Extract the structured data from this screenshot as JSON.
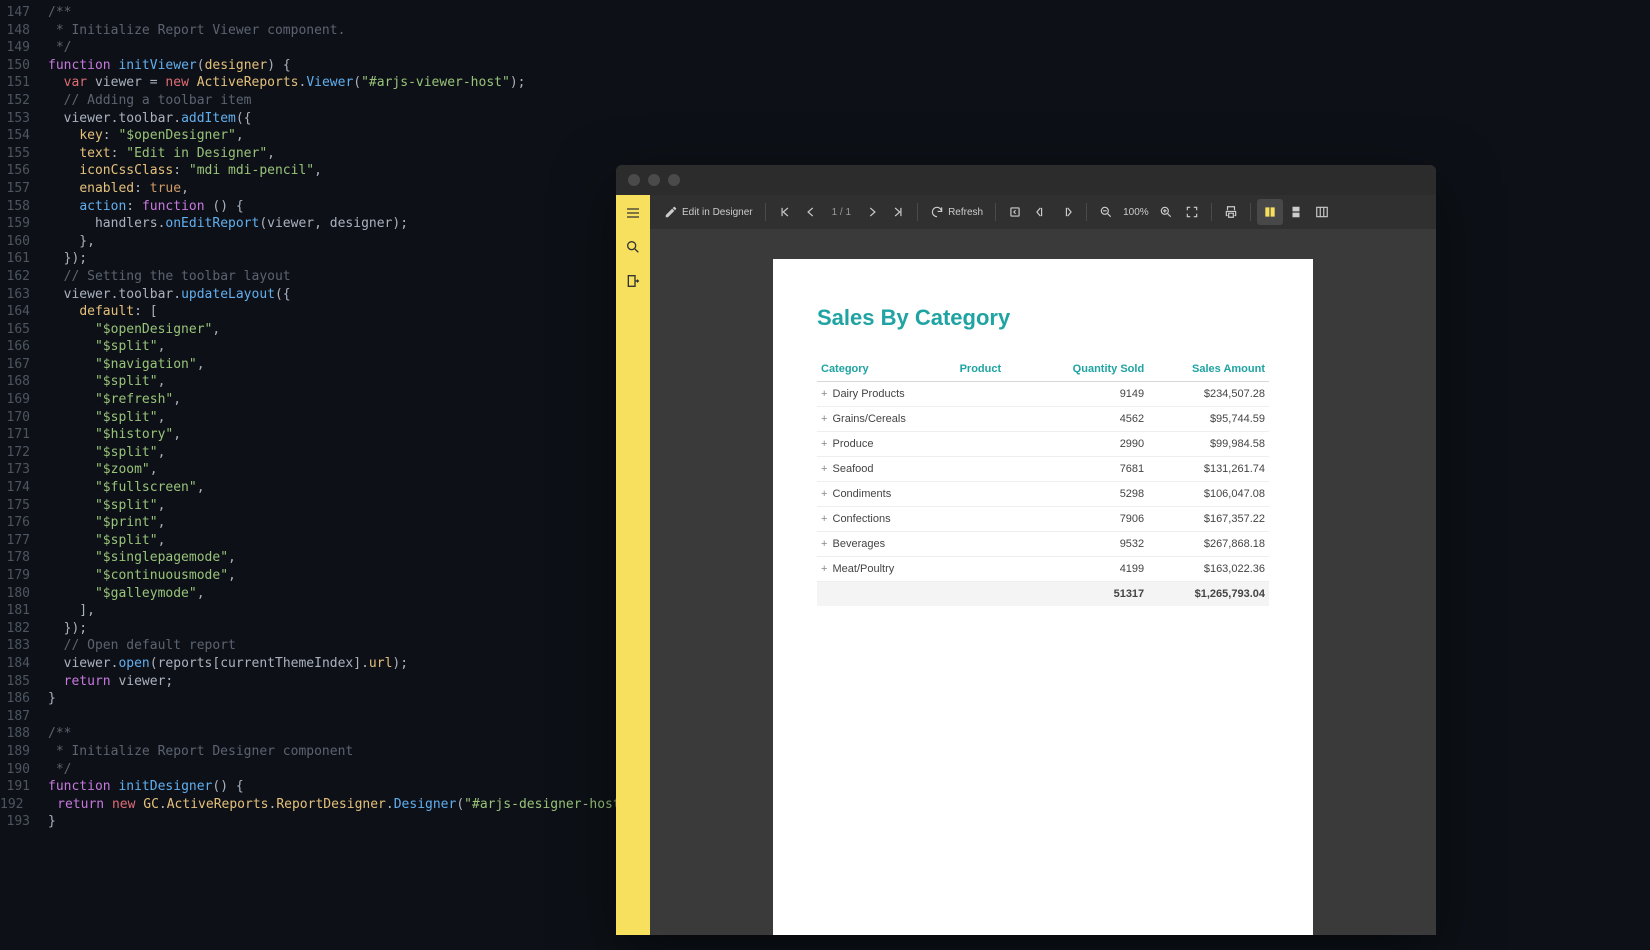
{
  "code": {
    "startLine": 147,
    "lines": [
      [
        [
          "c",
          "/**"
        ]
      ],
      [
        [
          "c",
          " * Initialize Report Viewer component."
        ]
      ],
      [
        [
          "c",
          " */"
        ]
      ],
      [
        [
          "k",
          "function"
        ],
        [
          "p",
          " "
        ],
        [
          "fn",
          "initViewer"
        ],
        [
          "p",
          "("
        ],
        [
          "ob",
          "designer"
        ],
        [
          "p",
          ") {"
        ]
      ],
      [
        [
          "p",
          "  "
        ],
        [
          "kw2",
          "var"
        ],
        [
          "p",
          " viewer = "
        ],
        [
          "kw2",
          "new"
        ],
        [
          "p",
          " "
        ],
        [
          "ob",
          "ActiveReports"
        ],
        [
          "p",
          "."
        ],
        [
          "fn",
          "Viewer"
        ],
        [
          "p",
          "("
        ],
        [
          "s",
          "\"#arjs-viewer-host\""
        ],
        [
          "p",
          ");"
        ]
      ],
      [
        [
          "p",
          "  "
        ],
        [
          "c",
          "// Adding a toolbar item"
        ]
      ],
      [
        [
          "p",
          "  viewer.toolbar."
        ],
        [
          "fn",
          "addItem"
        ],
        [
          "p",
          "({"
        ]
      ],
      [
        [
          "p",
          "    "
        ],
        [
          "ob",
          "key"
        ],
        [
          "p",
          ": "
        ],
        [
          "s",
          "\"$openDesigner\""
        ],
        [
          "p",
          ","
        ]
      ],
      [
        [
          "p",
          "    "
        ],
        [
          "ob",
          "text"
        ],
        [
          "p",
          ": "
        ],
        [
          "s",
          "\"Edit in Designer\""
        ],
        [
          "p",
          ","
        ]
      ],
      [
        [
          "p",
          "    "
        ],
        [
          "ob",
          "iconCssClass"
        ],
        [
          "p",
          ": "
        ],
        [
          "s",
          "\"mdi mdi-pencil\""
        ],
        [
          "p",
          ","
        ]
      ],
      [
        [
          "p",
          "    "
        ],
        [
          "ob",
          "enabled"
        ],
        [
          "p",
          ": "
        ],
        [
          "bool",
          "true"
        ],
        [
          "p",
          ","
        ]
      ],
      [
        [
          "p",
          "    "
        ],
        [
          "fn",
          "action"
        ],
        [
          "p",
          ": "
        ],
        [
          "k",
          "function"
        ],
        [
          "p",
          " () {"
        ]
      ],
      [
        [
          "p",
          "      handlers."
        ],
        [
          "fn",
          "onEditReport"
        ],
        [
          "p",
          "(viewer, designer);"
        ]
      ],
      [
        [
          "p",
          "    },"
        ]
      ],
      [
        [
          "p",
          "  });"
        ]
      ],
      [
        [
          "p",
          "  "
        ],
        [
          "c",
          "// Setting the toolbar layout"
        ]
      ],
      [
        [
          "p",
          "  viewer.toolbar."
        ],
        [
          "fn",
          "updateLayout"
        ],
        [
          "p",
          "({"
        ]
      ],
      [
        [
          "p",
          "    "
        ],
        [
          "ob",
          "default"
        ],
        [
          "p",
          ": ["
        ]
      ],
      [
        [
          "p",
          "      "
        ],
        [
          "s",
          "\"$openDesigner\""
        ],
        [
          "p",
          ","
        ]
      ],
      [
        [
          "p",
          "      "
        ],
        [
          "s",
          "\"$split\""
        ],
        [
          "p",
          ","
        ]
      ],
      [
        [
          "p",
          "      "
        ],
        [
          "s",
          "\"$navigation\""
        ],
        [
          "p",
          ","
        ]
      ],
      [
        [
          "p",
          "      "
        ],
        [
          "s",
          "\"$split\""
        ],
        [
          "p",
          ","
        ]
      ],
      [
        [
          "p",
          "      "
        ],
        [
          "s",
          "\"$refresh\""
        ],
        [
          "p",
          ","
        ]
      ],
      [
        [
          "p",
          "      "
        ],
        [
          "s",
          "\"$split\""
        ],
        [
          "p",
          ","
        ]
      ],
      [
        [
          "p",
          "      "
        ],
        [
          "s",
          "\"$history\""
        ],
        [
          "p",
          ","
        ]
      ],
      [
        [
          "p",
          "      "
        ],
        [
          "s",
          "\"$split\""
        ],
        [
          "p",
          ","
        ]
      ],
      [
        [
          "p",
          "      "
        ],
        [
          "s",
          "\"$zoom\""
        ],
        [
          "p",
          ","
        ]
      ],
      [
        [
          "p",
          "      "
        ],
        [
          "s",
          "\"$fullscreen\""
        ],
        [
          "p",
          ","
        ]
      ],
      [
        [
          "p",
          "      "
        ],
        [
          "s",
          "\"$split\""
        ],
        [
          "p",
          ","
        ]
      ],
      [
        [
          "p",
          "      "
        ],
        [
          "s",
          "\"$print\""
        ],
        [
          "p",
          ","
        ]
      ],
      [
        [
          "p",
          "      "
        ],
        [
          "s",
          "\"$split\""
        ],
        [
          "p",
          ","
        ]
      ],
      [
        [
          "p",
          "      "
        ],
        [
          "s",
          "\"$singlepagemode\""
        ],
        [
          "p",
          ","
        ]
      ],
      [
        [
          "p",
          "      "
        ],
        [
          "s",
          "\"$continuousmode\""
        ],
        [
          "p",
          ","
        ]
      ],
      [
        [
          "p",
          "      "
        ],
        [
          "s",
          "\"$galleymode\""
        ],
        [
          "p",
          ","
        ]
      ],
      [
        [
          "p",
          "    ],"
        ]
      ],
      [
        [
          "p",
          "  });"
        ]
      ],
      [
        [
          "p",
          "  "
        ],
        [
          "c",
          "// Open default report"
        ]
      ],
      [
        [
          "p",
          "  viewer."
        ],
        [
          "fn",
          "open"
        ],
        [
          "p",
          "(reports[currentThemeIndex]."
        ],
        [
          "ob",
          "url"
        ],
        [
          "p",
          ");"
        ]
      ],
      [
        [
          "p",
          "  "
        ],
        [
          "k",
          "return"
        ],
        [
          "p",
          " viewer;"
        ]
      ],
      [
        [
          "p",
          "}"
        ]
      ],
      [
        [
          "p",
          ""
        ]
      ],
      [
        [
          "c",
          "/**"
        ]
      ],
      [
        [
          "c",
          " * Initialize Report Designer component"
        ]
      ],
      [
        [
          "c",
          " */"
        ]
      ],
      [
        [
          "k",
          "function"
        ],
        [
          "p",
          " "
        ],
        [
          "fn",
          "initDesigner"
        ],
        [
          "p",
          "() {"
        ]
      ],
      [
        [
          "p",
          "  "
        ],
        [
          "k",
          "return"
        ],
        [
          "p",
          " "
        ],
        [
          "kw2",
          "new"
        ],
        [
          "p",
          " "
        ],
        [
          "ob",
          "GC"
        ],
        [
          "p",
          "."
        ],
        [
          "ob",
          "ActiveReports"
        ],
        [
          "p",
          "."
        ],
        [
          "ob",
          "ReportDesigner"
        ],
        [
          "p",
          "."
        ],
        [
          "fn",
          "Designer"
        ],
        [
          "p",
          "("
        ],
        [
          "s",
          "\"#arjs-designer-host\""
        ],
        [
          "p",
          ");"
        ]
      ],
      [
        [
          "p",
          "}"
        ]
      ]
    ]
  },
  "viewer": {
    "toolbar": {
      "edit_label": "Edit in Designer",
      "page_info": "1 / 1",
      "refresh_label": "Refresh",
      "zoom_value": "100%"
    },
    "report": {
      "title": "Sales By Category",
      "headers": {
        "category": "Category",
        "product": "Product",
        "qty": "Quantity Sold",
        "amount": "Sales Amount"
      },
      "rows": [
        {
          "category": "Dairy Products",
          "qty": "9149",
          "amount": "$234,507.28"
        },
        {
          "category": "Grains/Cereals",
          "qty": "4562",
          "amount": "$95,744.59"
        },
        {
          "category": "Produce",
          "qty": "2990",
          "amount": "$99,984.58"
        },
        {
          "category": "Seafood",
          "qty": "7681",
          "amount": "$131,261.74"
        },
        {
          "category": "Condiments",
          "qty": "5298",
          "amount": "$106,047.08"
        },
        {
          "category": "Confections",
          "qty": "7906",
          "amount": "$167,357.22"
        },
        {
          "category": "Beverages",
          "qty": "9532",
          "amount": "$267,868.18"
        },
        {
          "category": "Meat/Poultry",
          "qty": "4199",
          "amount": "$163,022.36"
        }
      ],
      "total": {
        "qty": "51317",
        "amount": "$1,265,793.04"
      }
    }
  }
}
